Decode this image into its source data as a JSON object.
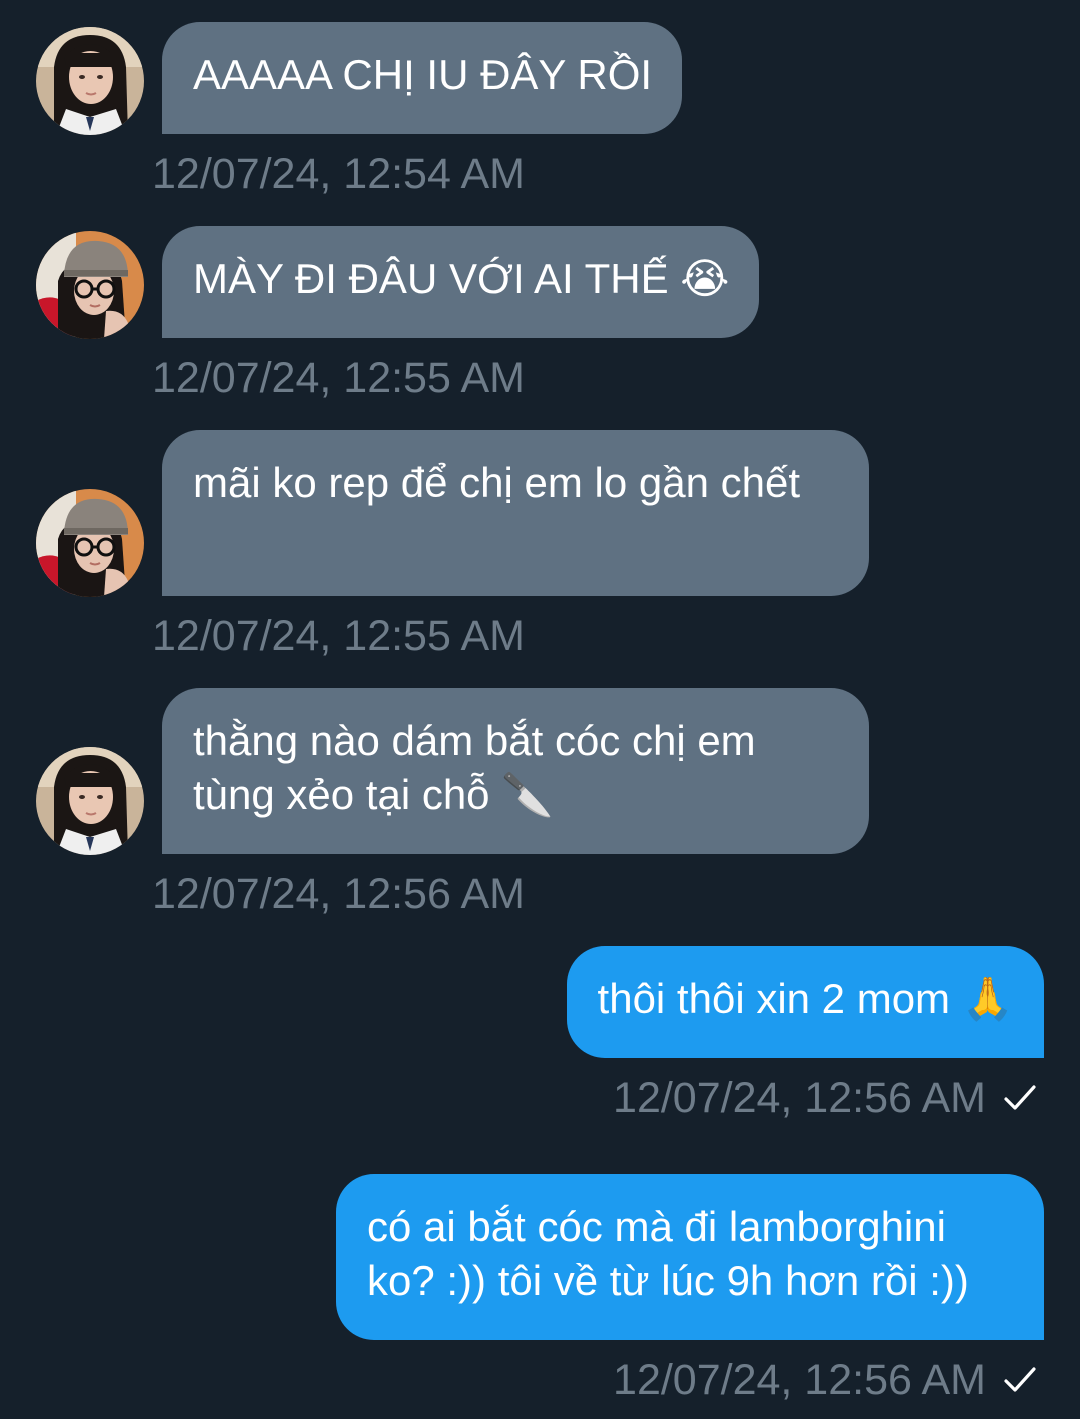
{
  "conversation": {
    "messages": [
      {
        "direction": "incoming",
        "avatar": "girl-bangs-avatar",
        "text": "AAAAA CHỊ IU ĐÂY RỒI",
        "timestamp": "12/07/24, 12:54 AM"
      },
      {
        "direction": "incoming",
        "avatar": "girl-beanie-glasses-avatar",
        "text": "MÀY ĐI ĐÂU VỚI AI THẾ 😭",
        "timestamp": "12/07/24, 12:55 AM"
      },
      {
        "direction": "incoming",
        "avatar": "girl-beanie-glasses-avatar",
        "text": "mãi ko rep để chị em lo gần chết",
        "timestamp": "12/07/24, 12:55 AM"
      },
      {
        "direction": "incoming",
        "avatar": "girl-bangs-avatar",
        "text": "thằng nào dám bắt cóc chị em tùng xẻo tại chỗ 🔪",
        "timestamp": "12/07/24, 12:56 AM"
      },
      {
        "direction": "outgoing",
        "text": "thôi thôi xin 2 mom 🙏",
        "timestamp": "12/07/24, 12:56 AM",
        "status": "check-icon"
      },
      {
        "direction": "outgoing",
        "text": "có ai bắt cóc mà đi lamborghini ko? :)) tôi về từ lúc 9h hơn rồi :))",
        "timestamp": "12/07/24, 12:56 AM",
        "status": "check-icon"
      }
    ]
  },
  "colors": {
    "background": "#15202b",
    "incoming_bubble": "#5f7182",
    "outgoing_bubble": "#1d9bf0",
    "timestamp": "#6e7c89"
  }
}
